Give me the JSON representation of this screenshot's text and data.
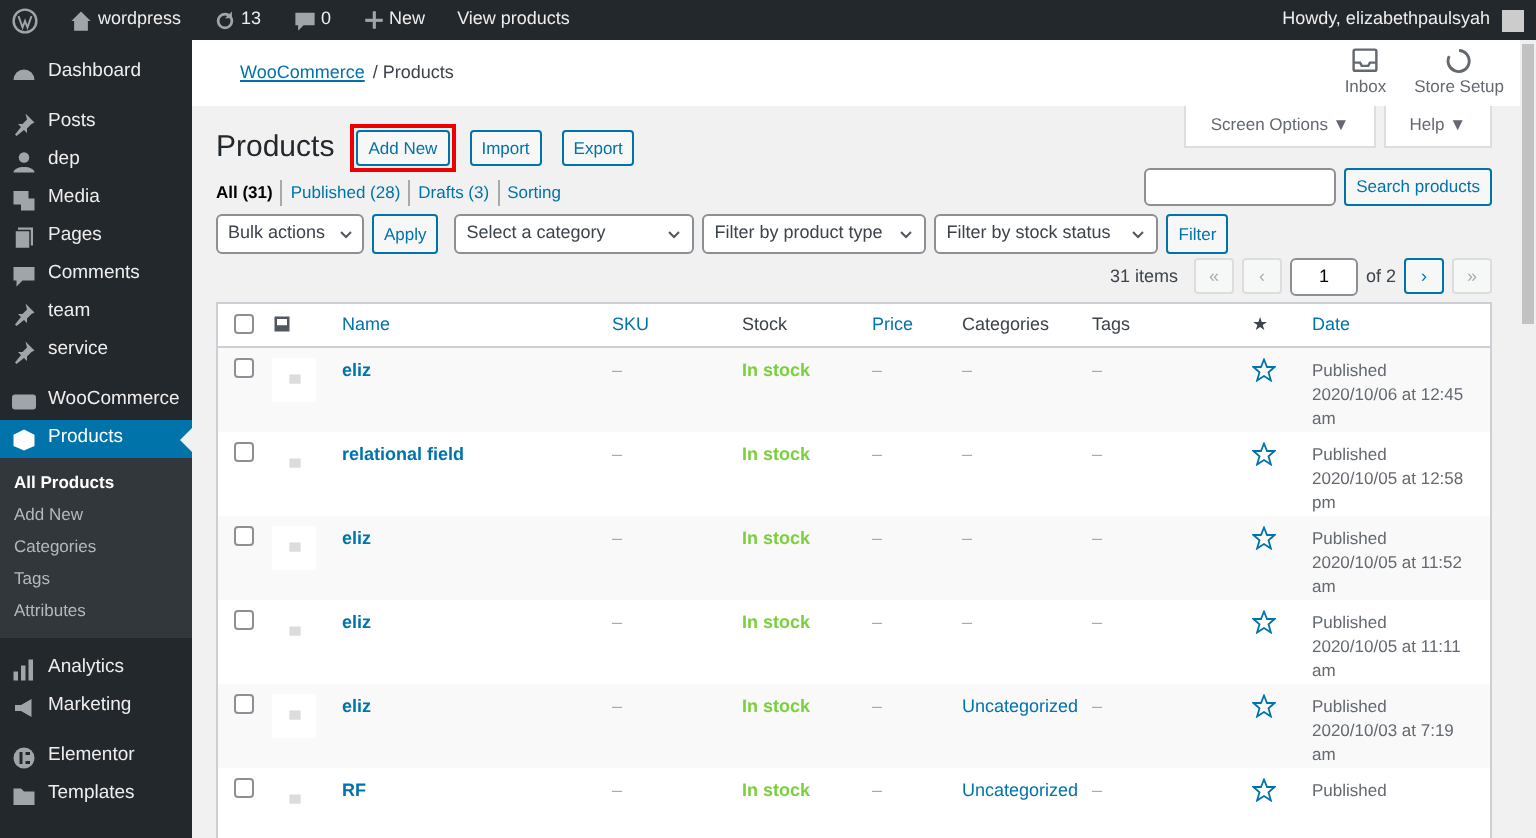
{
  "admin_bar": {
    "site": "wordpress",
    "updates": "13",
    "comments": "0",
    "new": "New",
    "view": "View products",
    "howdy": "Howdy, elizabethpaulsyah"
  },
  "sidebar": {
    "items": [
      {
        "label": "Dashboard",
        "selected": false
      },
      {
        "label": "Posts",
        "selected": false
      },
      {
        "label": "dep",
        "selected": false
      },
      {
        "label": "Media",
        "selected": false
      },
      {
        "label": "Pages",
        "selected": false
      },
      {
        "label": "Comments",
        "selected": false
      },
      {
        "label": "team",
        "selected": false
      },
      {
        "label": "service",
        "selected": false
      },
      {
        "label": "WooCommerce",
        "selected": false
      },
      {
        "label": "Products",
        "selected": true,
        "children": [
          {
            "label": "All Products",
            "selected": true
          },
          {
            "label": "Add New",
            "selected": false
          },
          {
            "label": "Categories",
            "selected": false
          },
          {
            "label": "Tags",
            "selected": false
          },
          {
            "label": "Attributes",
            "selected": false
          }
        ]
      },
      {
        "label": "Analytics",
        "selected": false
      },
      {
        "label": "Marketing",
        "selected": false
      },
      {
        "label": "Elementor",
        "selected": false
      },
      {
        "label": "Templates",
        "selected": false
      }
    ]
  },
  "header": {
    "breadcrumb_link": "WooCommerce",
    "breadcrumb_current": "/ Products",
    "actions": [
      {
        "label": "Inbox"
      },
      {
        "label": "Store Setup"
      }
    ]
  },
  "screen_tabs": [
    "Screen Options ▼",
    "Help ▼"
  ],
  "page_title": "Products",
  "title_buttons": [
    {
      "label": "Add New",
      "highlighted": true
    },
    {
      "label": "Import",
      "highlighted": false
    },
    {
      "label": "Export",
      "highlighted": false
    }
  ],
  "views": [
    {
      "label": "All",
      "count": "(31)",
      "selected": true
    },
    {
      "label": "Published",
      "count": "(28)",
      "selected": false
    },
    {
      "label": "Drafts",
      "count": "(3)",
      "selected": false
    },
    {
      "label": "Sorting",
      "selected": false
    }
  ],
  "search": {
    "button": "Search products"
  },
  "filters": [
    {
      "kind": "select",
      "label": "Bulk actions"
    },
    {
      "kind": "button",
      "label": "Apply"
    },
    {
      "kind": "select",
      "label": "Select a category"
    },
    {
      "kind": "select",
      "label": "Filter by product type"
    },
    {
      "kind": "select",
      "label": "Filter by stock status"
    },
    {
      "kind": "button",
      "label": "Filter"
    }
  ],
  "pagination": {
    "items": "31 items",
    "first": "«",
    "prev": "‹",
    "page": "1",
    "of": "of 2",
    "next": "›",
    "last": "»"
  },
  "table": {
    "select_all_checked": false,
    "columns": [
      {
        "label": "Name",
        "sortable": true
      },
      {
        "label": "SKU",
        "sortable": true
      },
      {
        "label": "Stock",
        "sortable": false
      },
      {
        "label": "Price",
        "sortable": true
      },
      {
        "label": "Categories",
        "sortable": false
      },
      {
        "label": "Tags",
        "sortable": false
      },
      {
        "label": "★",
        "sortable": false
      },
      {
        "label": "Date",
        "sortable": true
      }
    ],
    "rows": [
      {
        "checked": false,
        "name": "eliz",
        "sku": "–",
        "stock": "In stock",
        "price": "–",
        "categories": "–",
        "tags": "–",
        "featured": false,
        "status": "Published",
        "date": "2020/10/06 at 12:45 am"
      },
      {
        "checked": false,
        "name": "relational field",
        "sku": "–",
        "stock": "In stock",
        "price": "–",
        "categories": "–",
        "tags": "–",
        "featured": false,
        "status": "Published",
        "date": "2020/10/05 at 12:58 pm"
      },
      {
        "checked": false,
        "name": "eliz",
        "sku": "–",
        "stock": "In stock",
        "price": "–",
        "categories": "–",
        "tags": "–",
        "featured": false,
        "status": "Published",
        "date": "2020/10/05 at 11:52 am"
      },
      {
        "checked": false,
        "name": "eliz",
        "sku": "–",
        "stock": "In stock",
        "price": "–",
        "categories": "–",
        "tags": "–",
        "featured": false,
        "status": "Published",
        "date": "2020/10/05 at 11:11 am"
      },
      {
        "checked": false,
        "name": "eliz",
        "sku": "–",
        "stock": "In stock",
        "price": "–",
        "categories": "Uncategorized",
        "tags": "–",
        "featured": false,
        "status": "Published",
        "date": "2020/10/03 at 7:19 am"
      },
      {
        "checked": false,
        "name": "RF",
        "sku": "–",
        "stock": "In stock",
        "price": "–",
        "categories": "Uncategorized",
        "tags": "–",
        "featured": false,
        "status": "Published",
        "date": null
      }
    ]
  }
}
